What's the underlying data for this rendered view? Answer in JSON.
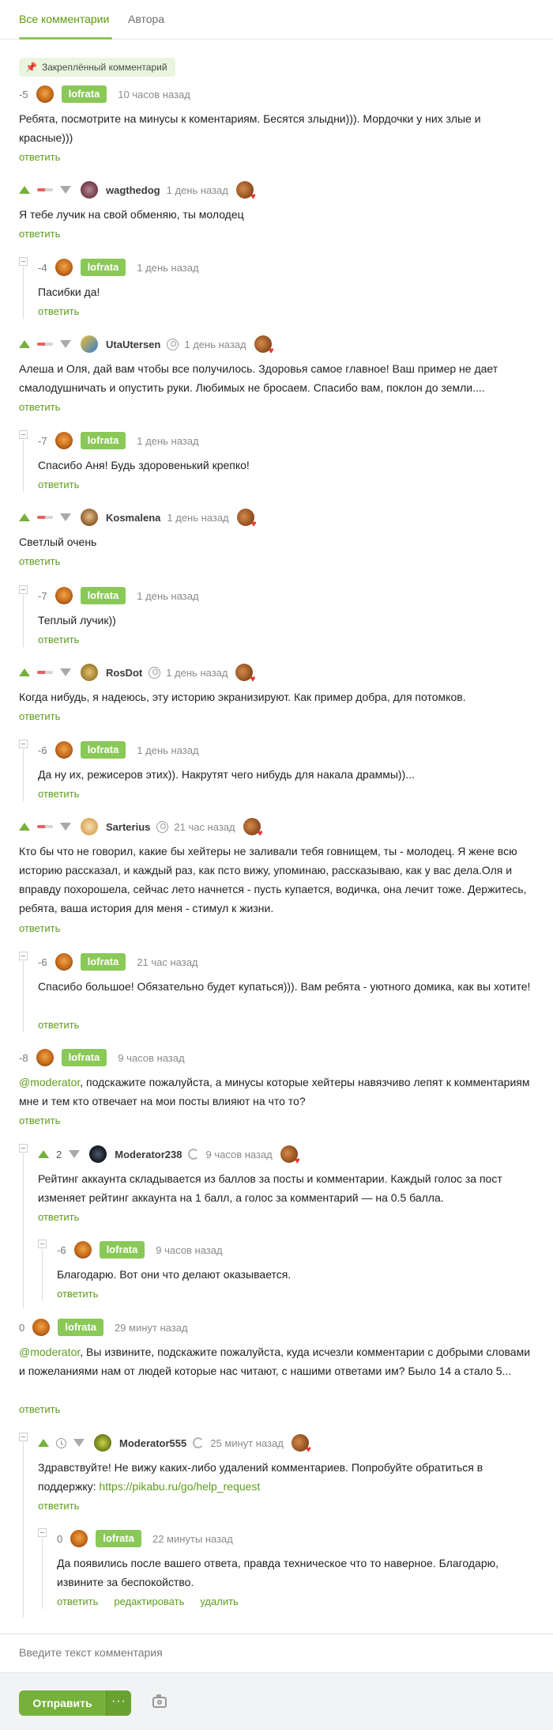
{
  "tabs": [
    {
      "label": "Все комментарии"
    },
    {
      "label": "Автора"
    }
  ],
  "pinned_label": "Закреплённый комментарий",
  "reply_label": "ответить",
  "edit_label": "редактировать",
  "delete_label": "удалить",
  "comments": [
    {
      "rating": "-5",
      "author": "lofrata",
      "time": "10 часов назад",
      "text": "Ребята, посмотрите на минусы к коментариям. Бесятся злыдни))). Мордочки у них злые и красные)))"
    },
    {
      "author": "wagthedog",
      "time": "1 день назад",
      "text": "Я тебе лучик на свой обменяю, ты молодец"
    },
    {
      "rating": "-4",
      "author": "lofrata",
      "time": "1 день назад",
      "text": "Пасибки да!"
    },
    {
      "author": "UtaUtersen",
      "time": "1 день назад",
      "text": "Алеша и Оля, дай вам чтобы все получилось. Здоровья самое главное! Ваш пример не дает смалодушничать и опустить руки. Любимых не бросаем. Спасибо вам, поклон до земли...."
    },
    {
      "rating": "-7",
      "author": "lofrata",
      "time": "1 день назад",
      "text": "Спасибо Аня! Будь здоровенький крепко!"
    },
    {
      "author": "Kosmalena",
      "time": "1 день назад",
      "text": "Светлый очень"
    },
    {
      "rating": "-7",
      "author": "lofrata",
      "time": "1 день назад",
      "text": "Теплый лучик))"
    },
    {
      "author": "RosDot",
      "time": "1 день назад",
      "text": "Когда нибудь, я надеюсь, эту историю экранизируют. Как пример добра, для потомков."
    },
    {
      "rating": "-6",
      "author": "lofrata",
      "time": "1 день назад",
      "text": "Да ну их, режисеров этих)). Накрутят чего нибудь для накала драммы))..."
    },
    {
      "author": "Sarterius",
      "time": "21 час назад",
      "text": "Кто бы что не говорил, какие бы хейтеры не заливали тебя говнищем, ты - молодец. Я жене всю историю рассказал, и каждый раз, как псто вижу, упоминаю, рассказываю, как у вас дела.Оля и вправду похорошела, сейчас лето начнется - пусть купается, водичка, она лечит тоже. Держитесь, ребята, ваша история для меня - стимул к жизни."
    },
    {
      "rating": "-6",
      "author": "lofrata",
      "time": "21 час назад",
      "text": "Спасибо большое! Обязательно будет купаться))). Вам ребята - уютного домика, как вы хотите!"
    },
    {
      "rating": "-8",
      "author": "lofrata",
      "time": "9 часов назад",
      "mention": "@moderator",
      "text": ", подскажите пожалуйста, а минусы которые хейтеры навязчиво лепят к комментариям мне и тем кто отвечает на мои посты влияют на что то?"
    },
    {
      "votes": "2",
      "author": "Moderator238",
      "time": "9 часов назад",
      "text": "Рейтинг аккаунта складывается из баллов за посты и комментарии. Каждый голос за пост изменяет рейтинг аккаунта на 1 балл, а голос за комментарий — на 0.5 балла."
    },
    {
      "rating": "-6",
      "author": "lofrata",
      "time": "9 часов назад",
      "text": "Благодарю. Вот они что делают оказывается."
    },
    {
      "rating": "0",
      "author": "lofrata",
      "time": "29 минут назад",
      "mention": "@moderator",
      "text": ", Вы извините, подскажите пожалуйста, куда исчезли комментарии с добрыми словами и пожеланиями нам от людей которые нас читают, с нашими ответами им? Было 14 а стало 5..."
    },
    {
      "author": "Moderator555",
      "time": "25 минут назад",
      "text": "Здравствуйте! Не вижу каких-либо удалений комментариев. Попробуйте обратиться в поддержку: ",
      "link": "https://pikabu.ru/go/help_request"
    },
    {
      "rating": "0",
      "author": "lofrata",
      "time": "22 минуты назад",
      "text": "Да появились после вашего ответа, правда техническое что то наверное. Благодарю, извините за беспокойство."
    }
  ],
  "composer": {
    "placeholder": "Введите текст комментария",
    "send_label": "Отправить",
    "more_label": "···"
  }
}
